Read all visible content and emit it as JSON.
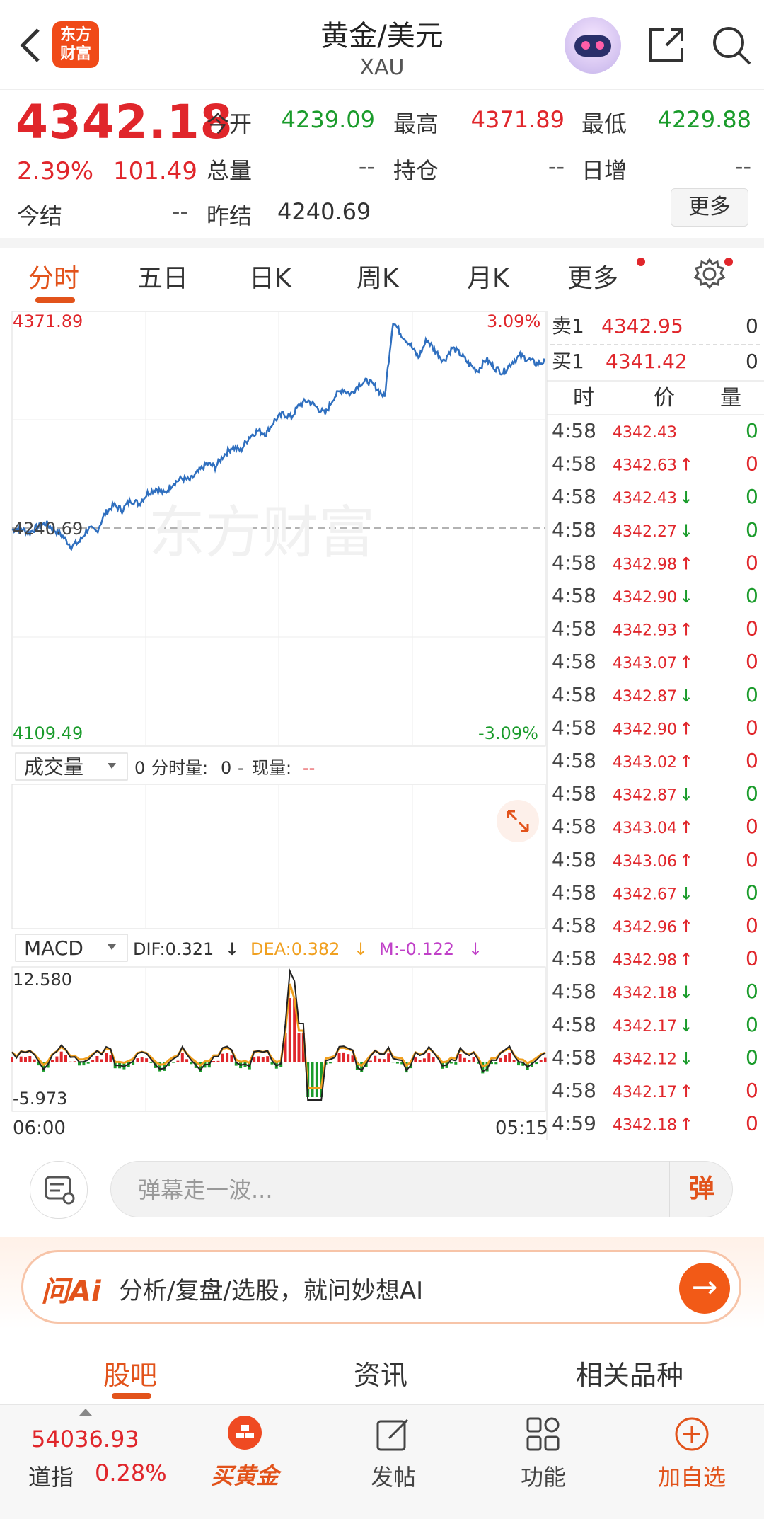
{
  "header": {
    "logo_text_line1": "东方",
    "logo_text_line2": "财富",
    "title": "黄金/美元",
    "subtitle": "XAU"
  },
  "quote": {
    "price": "4342.18",
    "change_pct": "2.39%",
    "change_val": "101.49",
    "open_label": "今开",
    "open_val": "4239.09",
    "high_label": "最高",
    "high_val": "4371.89",
    "low_label": "最低",
    "low_val": "4229.88",
    "volume_label": "总量",
    "volume_val": "--",
    "position_label": "持仓",
    "position_val": "--",
    "daily_inc_label": "日增",
    "daily_inc_val": "--",
    "settle_label": "今结",
    "settle_val": "--",
    "prev_settle_label": "昨结",
    "prev_settle_val": "4240.69",
    "more_label": "更多"
  },
  "tabs": [
    "分时",
    "五日",
    "日K",
    "周K",
    "月K",
    "更多"
  ],
  "chart": {
    "watermark": "东方财富",
    "y_max": "4371.89",
    "y_min": "4109.49",
    "pct_max": "3.09%",
    "pct_min": "-3.09%",
    "base_label": "4240.69",
    "volume_selector": "成交量",
    "volume_info_a": "0",
    "volume_info_b": "分时量:",
    "volume_info_c": "0",
    "volume_info_d": "-",
    "volume_info_e": "现量:",
    "volume_info_f": "--",
    "macd_selector": "MACD",
    "dif": "DIF:0.321",
    "dea": "DEA:0.382",
    "m": "M:-0.122",
    "macd_max": "12.580",
    "macd_min": "-5.973",
    "time_start": "06:00",
    "time_end": "05:15"
  },
  "orderbook": {
    "sell_label": "卖1",
    "sell_price": "4342.95",
    "sell_vol": "0",
    "buy_label": "买1",
    "buy_price": "4341.42",
    "buy_vol": "0",
    "col_time": "时",
    "col_price": "价",
    "col_vol": "量"
  },
  "ticks": [
    {
      "t": "4:58",
      "p": "4342.43",
      "d": "",
      "v": "0",
      "c": "green"
    },
    {
      "t": "4:58",
      "p": "4342.63",
      "d": "↑",
      "v": "0",
      "c": "red"
    },
    {
      "t": "4:58",
      "p": "4342.43",
      "d": "↓",
      "v": "0",
      "c": "green"
    },
    {
      "t": "4:58",
      "p": "4342.27",
      "d": "↓",
      "v": "0",
      "c": "green"
    },
    {
      "t": "4:58",
      "p": "4342.98",
      "d": "↑",
      "v": "0",
      "c": "red"
    },
    {
      "t": "4:58",
      "p": "4342.90",
      "d": "↓",
      "v": "0",
      "c": "green"
    },
    {
      "t": "4:58",
      "p": "4342.93",
      "d": "↑",
      "v": "0",
      "c": "red"
    },
    {
      "t": "4:58",
      "p": "4343.07",
      "d": "↑",
      "v": "0",
      "c": "red"
    },
    {
      "t": "4:58",
      "p": "4342.87",
      "d": "↓",
      "v": "0",
      "c": "green"
    },
    {
      "t": "4:58",
      "p": "4342.90",
      "d": "↑",
      "v": "0",
      "c": "red"
    },
    {
      "t": "4:58",
      "p": "4343.02",
      "d": "↑",
      "v": "0",
      "c": "red"
    },
    {
      "t": "4:58",
      "p": "4342.87",
      "d": "↓",
      "v": "0",
      "c": "green"
    },
    {
      "t": "4:58",
      "p": "4343.04",
      "d": "↑",
      "v": "0",
      "c": "red"
    },
    {
      "t": "4:58",
      "p": "4343.06",
      "d": "↑",
      "v": "0",
      "c": "red"
    },
    {
      "t": "4:58",
      "p": "4342.67",
      "d": "↓",
      "v": "0",
      "c": "green"
    },
    {
      "t": "4:58",
      "p": "4342.96",
      "d": "↑",
      "v": "0",
      "c": "red"
    },
    {
      "t": "4:58",
      "p": "4342.98",
      "d": "↑",
      "v": "0",
      "c": "red"
    },
    {
      "t": "4:58",
      "p": "4342.18",
      "d": "↓",
      "v": "0",
      "c": "green"
    },
    {
      "t": "4:58",
      "p": "4342.17",
      "d": "↓",
      "v": "0",
      "c": "green"
    },
    {
      "t": "4:58",
      "p": "4342.12",
      "d": "↓",
      "v": "0",
      "c": "green"
    },
    {
      "t": "4:58",
      "p": "4342.17",
      "d": "↑",
      "v": "0",
      "c": "red"
    },
    {
      "t": "4:59",
      "p": "4342.18",
      "d": "↑",
      "v": "0",
      "c": "red"
    }
  ],
  "danmu": {
    "placeholder": "弹幕走一波...",
    "btn": "弹"
  },
  "ai": {
    "logo": "问Ai",
    "text": "分析/复盘/选股，就问妙想AI"
  },
  "bottom_tabs": [
    "股吧",
    "资讯",
    "相关品种"
  ],
  "bottom_bar": {
    "index_value": "54036.93",
    "index_name": "道指",
    "index_pct": "0.28%",
    "buy_gold": "买黄金",
    "post": "发帖",
    "functions": "功能",
    "add_watch": "加自选"
  },
  "colors": {
    "red": "#e0262b",
    "green": "#1a9b2b",
    "accent": "#e2531b",
    "line": "#2f6fbf"
  },
  "chart_data": {
    "type": "line",
    "ylim": [
      4109.49,
      4371.89
    ],
    "base": 4240.69,
    "x": [
      "06:00",
      "05:15"
    ],
    "values": [
      4240,
      4241,
      4238,
      4242,
      4244,
      4240,
      4236,
      4230,
      4233,
      4241,
      4239,
      4250,
      4255,
      4252,
      4258,
      4256,
      4262,
      4265,
      4262,
      4268,
      4271,
      4270,
      4275,
      4280,
      4278,
      4285,
      4290,
      4288,
      4296,
      4300,
      4298,
      4306,
      4310,
      4308,
      4316,
      4318,
      4314,
      4310,
      4320,
      4325,
      4322,
      4328,
      4330,
      4326,
      4320,
      4366,
      4358,
      4352,
      4344,
      4355,
      4348,
      4342,
      4350,
      4346,
      4340,
      4336,
      4343,
      4338,
      4335,
      4341,
      4345,
      4343,
      4340,
      4342
    ]
  }
}
